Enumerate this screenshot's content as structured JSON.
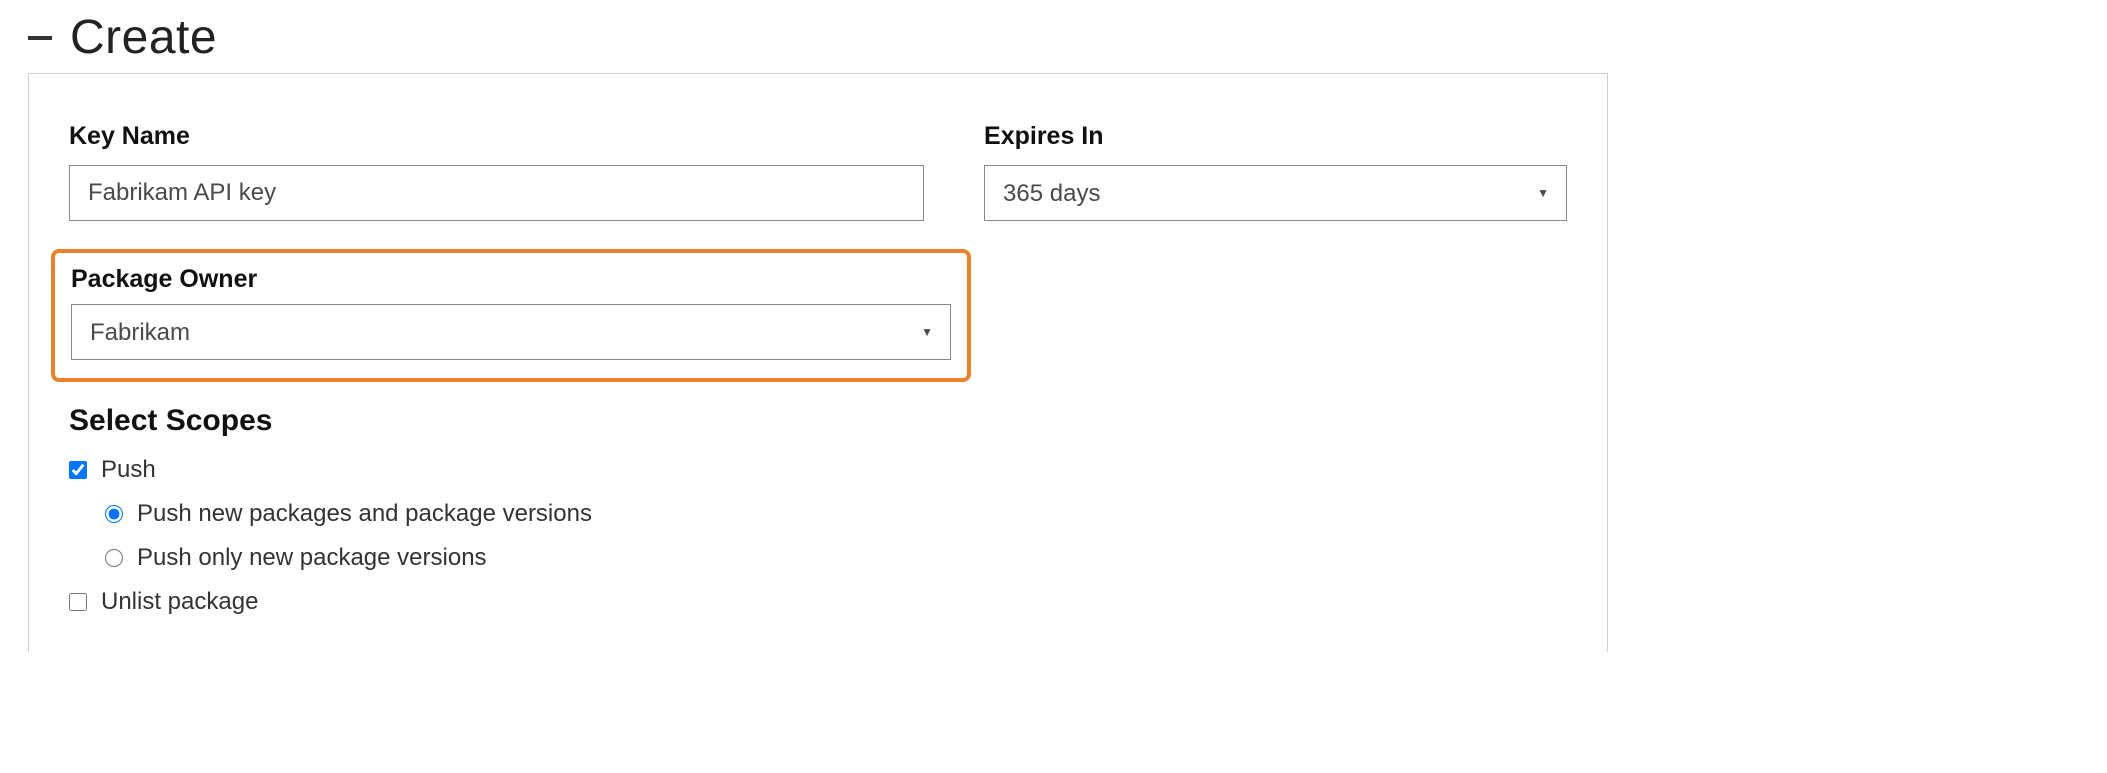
{
  "header": {
    "title": "Create"
  },
  "form": {
    "keyName": {
      "label": "Key Name",
      "value": "Fabrikam API key"
    },
    "expiresIn": {
      "label": "Expires In",
      "value": "365 days"
    },
    "packageOwner": {
      "label": "Package Owner",
      "value": "Fabrikam"
    },
    "scopes": {
      "title": "Select Scopes",
      "push": {
        "label": "Push",
        "checked": true,
        "options": {
          "newAndVersions": {
            "label": "Push new packages and package versions",
            "selected": true
          },
          "versionsOnly": {
            "label": "Push only new package versions",
            "selected": false
          }
        }
      },
      "unlist": {
        "label": "Unlist package",
        "checked": false
      }
    }
  }
}
